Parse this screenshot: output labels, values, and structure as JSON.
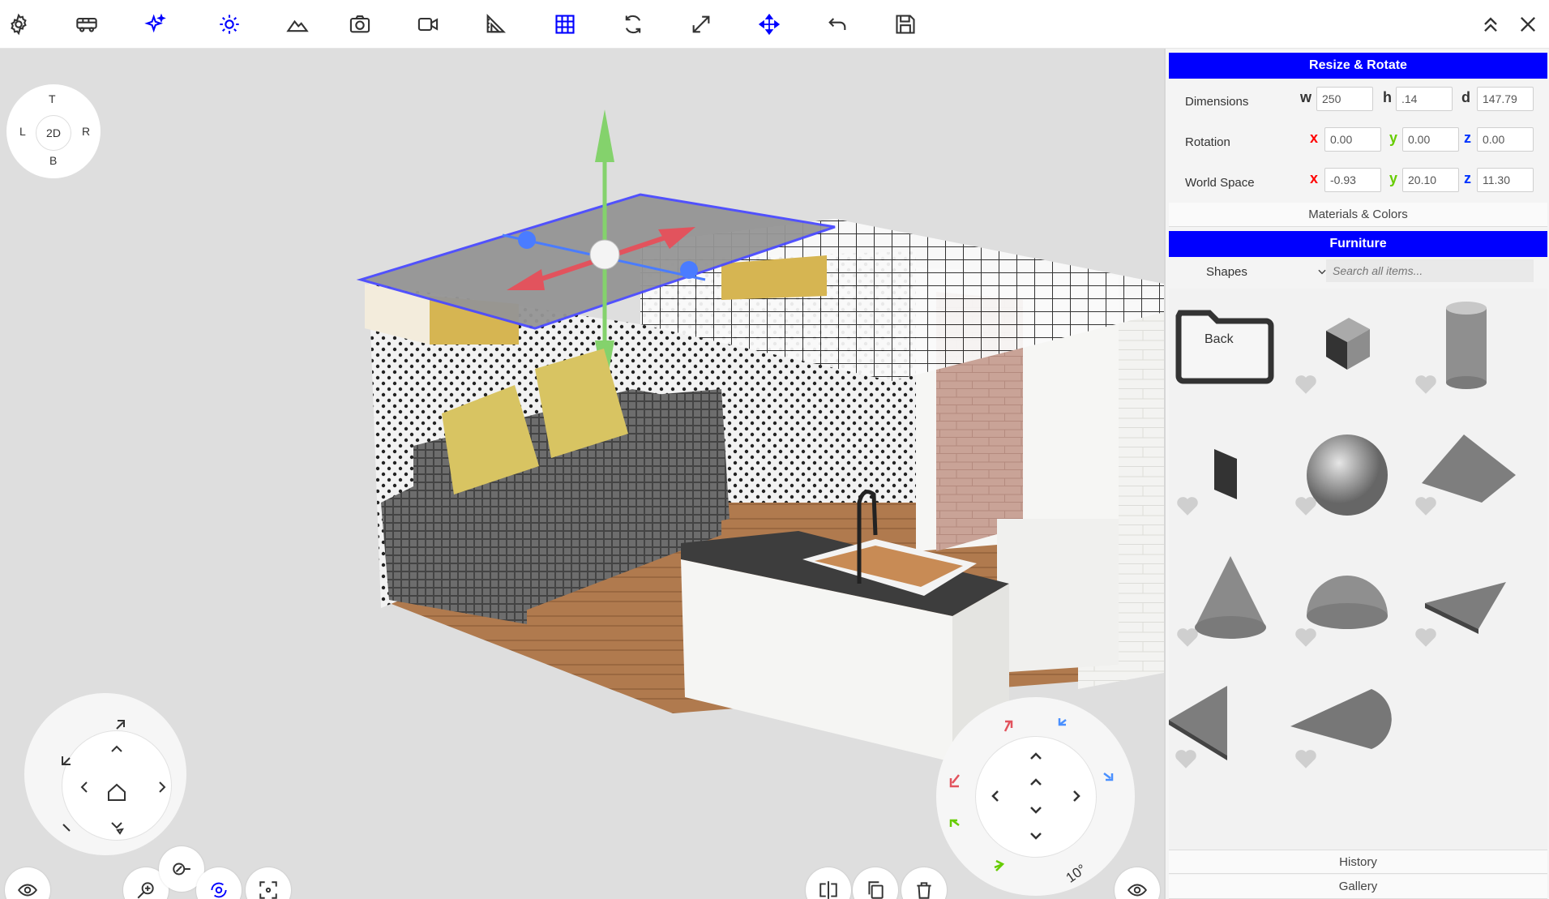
{
  "toolbar": {
    "icons": [
      "settings-icon",
      "delivery-truck-icon",
      "sparkle-icon",
      "sun-icon",
      "mountain-icon",
      "camera-icon",
      "video-camera-icon",
      "ruler-angle-icon",
      "grid-icon",
      "rotate-icon",
      "expand-icon",
      "move-icon",
      "undo-icon",
      "save-icon",
      "collapse-up-icon",
      "close-icon"
    ],
    "active_color": "#0000ff"
  },
  "view_cube": {
    "top": "T",
    "left": "L",
    "center": "2D",
    "right": "R",
    "bottom": "B"
  },
  "resize_rotate": {
    "title": "Resize & Rotate",
    "dimensions": {
      "label": "Dimensions",
      "w_label": "w",
      "w": "250",
      "h_label": "h",
      "h": ".14",
      "d_label": "d",
      "d": "147.79"
    },
    "rotation": {
      "label": "Rotation",
      "x_label": "x",
      "x": "0.00",
      "y_label": "y",
      "y": "0.00",
      "z_label": "z",
      "z": "0.00"
    },
    "world_space": {
      "label": "World Space",
      "x_label": "x",
      "x": "-0.93",
      "y_label": "y",
      "y": "20.10",
      "z_label": "z",
      "z": "11.30"
    },
    "axis_colors": {
      "x": "#ff0000",
      "y": "#66cc00",
      "z": "#0033ff"
    }
  },
  "materials_colors": "Materials & Colors",
  "furniture": {
    "title": "Furniture",
    "category": "Shapes",
    "search_placeholder": "Search all items...",
    "back_label": "Back",
    "items": [
      "cube",
      "cylinder",
      "plane",
      "sphere",
      "pyramid",
      "cone",
      "dome",
      "wedge",
      "triangle",
      "half-disc"
    ]
  },
  "history": "History",
  "gallery": "Gallery",
  "rotation_step": "10°"
}
